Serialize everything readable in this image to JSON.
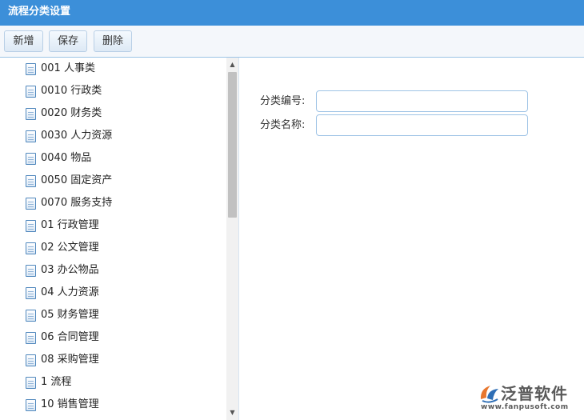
{
  "window": {
    "title": "流程分类设置"
  },
  "toolbar": {
    "add_label": "新增",
    "save_label": "保存",
    "delete_label": "删除"
  },
  "tree": {
    "items": [
      {
        "label": "001 人事类"
      },
      {
        "label": "0010 行政类"
      },
      {
        "label": "0020 财务类"
      },
      {
        "label": "0030 人力资源"
      },
      {
        "label": "0040 物品"
      },
      {
        "label": "0050 固定资产"
      },
      {
        "label": "0070 服务支持"
      },
      {
        "label": "01 行政管理"
      },
      {
        "label": "02 公文管理"
      },
      {
        "label": "03 办公物品"
      },
      {
        "label": "04 人力资源"
      },
      {
        "label": "05 财务管理"
      },
      {
        "label": "06 合同管理"
      },
      {
        "label": "08 采购管理"
      },
      {
        "label": "1 流程"
      },
      {
        "label": "10 销售管理"
      }
    ],
    "icon": "document-icon"
  },
  "form": {
    "code_label": "分类编号:",
    "code_value": "",
    "name_label": "分类名称:",
    "name_value": ""
  },
  "watermark": {
    "brand": "泛普软件",
    "url": "www.fanpusoft.com"
  },
  "colors": {
    "titlebar": "#3c8fd9",
    "accent_border": "#9cc3e6",
    "logo_orange": "#e8772e",
    "logo_blue": "#2f6fb6"
  }
}
